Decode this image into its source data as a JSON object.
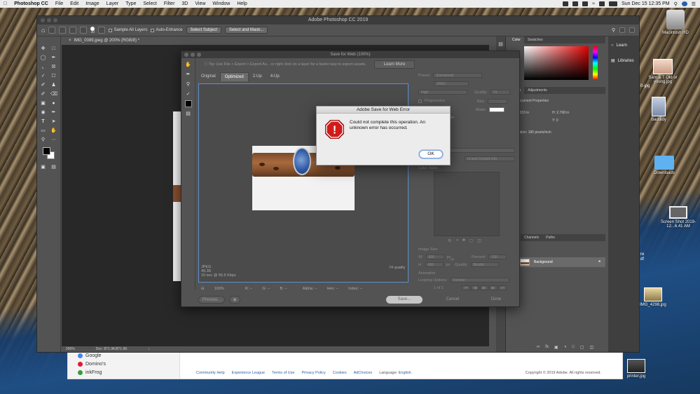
{
  "menubar": {
    "app": "Photoshop CC",
    "items": [
      "File",
      "Edit",
      "Image",
      "Layer",
      "Type",
      "Select",
      "Filter",
      "3D",
      "View",
      "Window",
      "Help"
    ],
    "clock": "Sun Dec 15  12:35 PM"
  },
  "photoshop": {
    "window_title": "Adobe Photoshop CC 2019",
    "options": {
      "brush_size": "30",
      "sample_all_layers": "Sample All Layers",
      "auto_enhance": "Auto-Enhance",
      "select_subject": "Select Subject",
      "select_and_mask": "Select and Mask..."
    },
    "document_tab": "IMG_0089.jpeg @ 200% (RGB/8) *",
    "status": {
      "zoom": "200%",
      "doc": "Doc: 871.9K/871.9K"
    },
    "panels": {
      "color_tabs": [
        "Color",
        "Swatches"
      ],
      "properties_tabs": [
        "erties",
        "Adjustments"
      ],
      "document_properties": "Document Properties",
      "width_value": ".333 in",
      "height_value": "H:  2.768 in",
      "y_value": "Y:  0",
      "resolution": "ution: 180 pixels/inch",
      "layers_tabs": [
        "ers",
        "Channels",
        "Paths"
      ],
      "layer_name": "Background"
    },
    "learn_panel": {
      "learn": "Learn",
      "libraries": "Libraries"
    }
  },
  "save_for_web": {
    "title": "Save for Web (100%)",
    "tip": "Tip: Use File > Export > Export As... or right click on a layer for a faster way to export assets.",
    "learn_more": "Learn More",
    "tabs": [
      "Original",
      "Optimized",
      "2-Up",
      "4-Up"
    ],
    "active_tab": "Optimized",
    "preview_info": {
      "format": "JPEG",
      "size": "49.3K",
      "time": "10 sec @ 56.6 Kbps",
      "quality": "74 quality"
    },
    "bottom_readouts": {
      "zoom": "100%",
      "r": "R: --",
      "g": "G: --",
      "b": "B: --",
      "alpha": "Alpha: --",
      "hex": "Hex: --",
      "index": "Index: --"
    },
    "settings": {
      "preset_label": "Preset:",
      "preset_value": "[Unnamed]",
      "format": "JPEG",
      "compression": "High",
      "quality_label": "Quality:",
      "quality_value": "74",
      "progressive": "Progressive",
      "blur_label": "Blur:",
      "matte_label": "Matte:",
      "profile_partial": "file",
      "metadata": "nt and Contact Info",
      "color_table": "Color Table",
      "image_size": "Image Size",
      "w_label": "W:",
      "w_value": "600",
      "h_label": "H:",
      "h_value": "450",
      "px": "px",
      "percent_label": "Percent:",
      "percent_value": "100",
      "quality_resample_label": "Quality:",
      "quality_resample_value": "Bicubic",
      "animation": "Animation",
      "looping_label": "Looping Options:",
      "looping_value": "Forever",
      "frame_counter": "1 of 1"
    },
    "buttons": {
      "preview": "Preview...",
      "save": "Save...",
      "cancel": "Cancel",
      "done": "Done"
    }
  },
  "error_dialog": {
    "title": "Adobe Save for Web Error",
    "message": "Could not complete this operation. An unknown error has occurred.",
    "ok": "OK",
    "icon_mark": "!"
  },
  "browser": {
    "bookmarks": [
      "Google",
      "Domino's",
      "inkFrog"
    ],
    "footer_links": [
      "Community Help",
      "Experience League",
      "Terms of Use",
      "Privacy Policy",
      "Cookies",
      "AdChoices"
    ],
    "language_label": "Language:",
    "language_value": "English",
    "copyright": "Copyright © 2019 Adobe. All rights reserved."
  },
  "desktop_icons": [
    "Macintosh HD",
    "Sam & T Old or young.jpg",
    "Baddidy",
    "Downloads",
    "Screen Shot 2019-12...6.41 AM",
    "IMG_4298.jpg",
    "printer.jpg"
  ],
  "desktop_partial": [
    "0-jpg",
    "re",
    "df"
  ]
}
